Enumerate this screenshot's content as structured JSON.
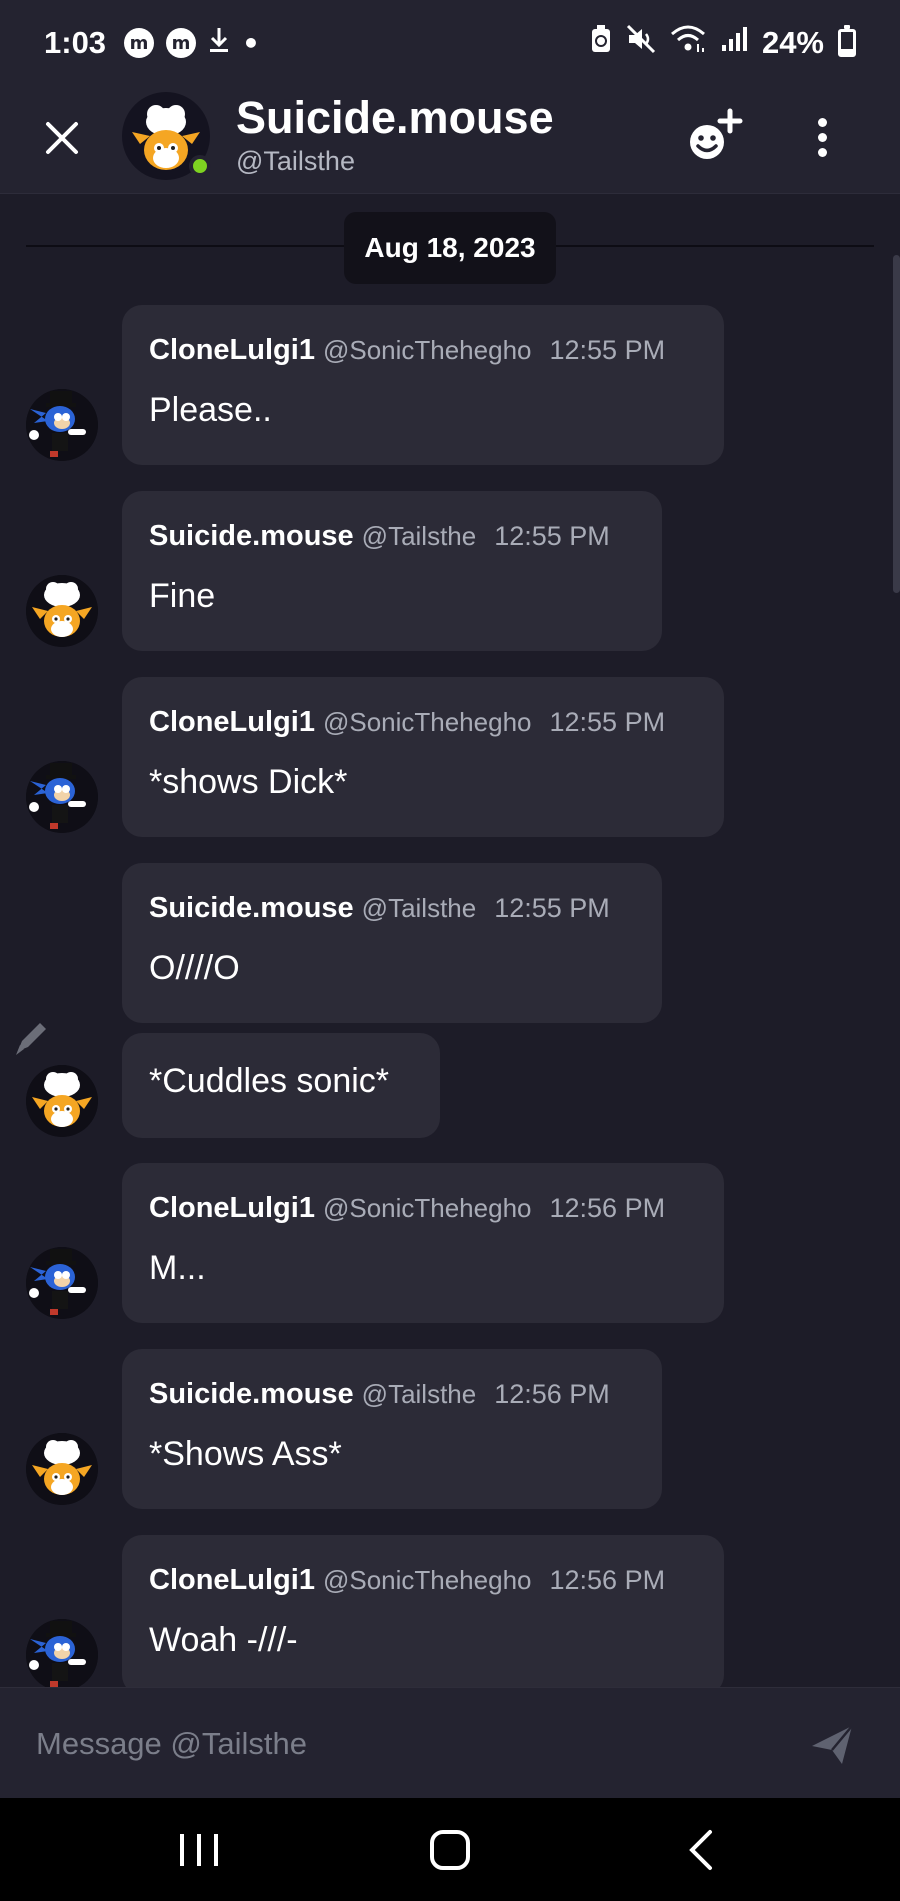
{
  "status_bar": {
    "time": "1:03",
    "app_icon_1": "m-circle-icon",
    "app_icon_2": "m-circle-icon",
    "download": "download-icon",
    "dot": "•",
    "battery": "24%",
    "battery_level": 0.24
  },
  "header": {
    "name": "Suicide.mouse",
    "handle": "@Tailsthe",
    "online_color": "#7ed321"
  },
  "date_divider": "Aug 18, 2023",
  "messages": [
    {
      "author": "CloneLulgi1",
      "handle": "@SonicThehegho",
      "time": "12:55 PM",
      "text": "Please.."
    },
    {
      "author": "Suicide.mouse",
      "handle": "@Tailsthe",
      "time": "12:55 PM",
      "text": "Fine"
    },
    {
      "author": "CloneLulgi1",
      "handle": "@SonicThehegho",
      "time": "12:55 PM",
      "text": "*shows Dick*"
    },
    {
      "author": "Suicide.mouse",
      "handle": "@Tailsthe",
      "time": "12:55 PM",
      "text": "O////O"
    },
    {
      "text": "*Cuddles sonic*"
    },
    {
      "author": "CloneLulgi1",
      "handle": "@SonicThehegho",
      "time": "12:56 PM",
      "text": "M..."
    },
    {
      "author": "Suicide.mouse",
      "handle": "@Tailsthe",
      "time": "12:56 PM",
      "text": "*Shows Ass*"
    },
    {
      "author": "CloneLulgi1",
      "handle": "@SonicThehegho",
      "time": "12:56 PM",
      "text": "Woah -///-"
    }
  ],
  "composer": {
    "placeholder": "Message @Tailsthe"
  },
  "colors": {
    "background": "#1d1c28",
    "bubble": "#2c2b37",
    "header": "#242330"
  }
}
